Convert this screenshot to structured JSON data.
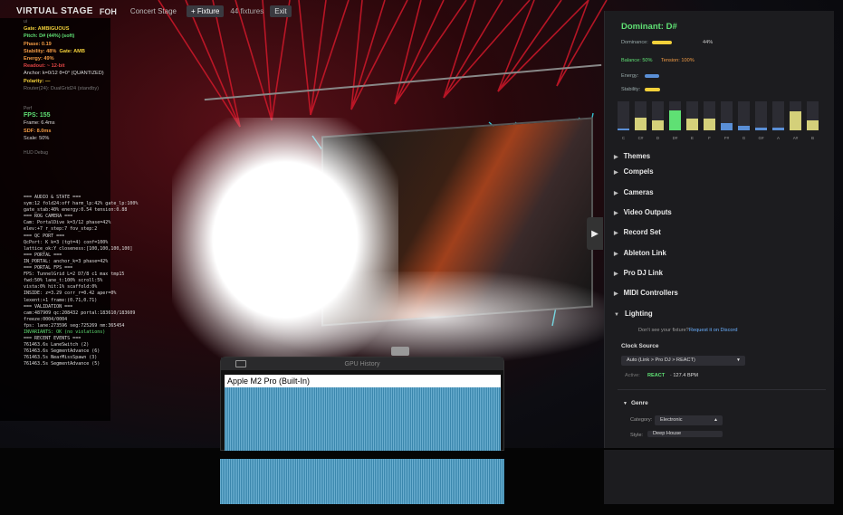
{
  "topbar": {
    "title": "VIRTUAL STAGE",
    "fps": "FOH",
    "concert_stage": "Concert Stage",
    "add_fixture": "+ Fixture",
    "fixture_count": "44 fixtures",
    "exit": "Exit"
  },
  "hud": {
    "head_ui": "ui",
    "gate": "Gate: AMBIGUOUS",
    "pitch": "Pitch: D# (44%) (soft)",
    "phase": "Phase: 0.19",
    "stability": "Stability: 48%",
    "gate_amb": "Gate: AMB",
    "energy": "Energy: 49%",
    "readout": "Readout: ~ 12-bit",
    "anchor": "Anchor: k=0/12 θ=0° (QUANTIZED)",
    "polarity": "Polarity: —",
    "router": "Router(24): DualGrid24 (standby)",
    "head_perf": "Perf",
    "fps": "FPS: 155",
    "frame": "Frame: 6.4ms",
    "sdf": "SDF: 8.0ms",
    "scale": "Scale: 50%",
    "head_debug": "HUD Debug"
  },
  "log": [
    {
      "t": "=== AUDIO & STATE ===",
      "c": "w"
    },
    {
      "t": "sym:12 fold24:off harm_lp:42% gate_lp:100%",
      "c": "w"
    },
    {
      "t": "gate_stab:40% energy:0.54 tension:0.88",
      "c": "w"
    },
    {
      "t": "=== ROG CAMERA ===",
      "c": "w"
    },
    {
      "t": "Cam: PortalDive k=3/12 phase=42%",
      "c": "w"
    },
    {
      "t": "elev:+7 r_step:7 fov_step:2",
      "c": "w"
    },
    {
      "t": "=== QC PORT ===",
      "c": "w"
    },
    {
      "t": "QcPort: K k=3 (tgt=4) conf=100%",
      "c": "w"
    },
    {
      "t": "lattice_ok:Y closeness:[100,100,100,100]",
      "c": "w"
    },
    {
      "t": "=== PORTAL ===",
      "c": "w"
    },
    {
      "t": "IN_PORTAL: anchor_k=3 phase=42%",
      "c": "w"
    },
    {
      "t": "=== PORTAL FPS ===",
      "c": "w"
    },
    {
      "t": "FPS: TunnelGrid L=2 D7/8 c1 max tmp15",
      "c": "w"
    },
    {
      "t": "fwd:50% lane_t:100% scroll:5%",
      "c": "w"
    },
    {
      "t": "vista:0% hit:1% scaffold:0%",
      "c": "w"
    },
    {
      "t": "INSIDE: z=3.29 corr_r=0.42 aper=0%",
      "c": "w"
    },
    {
      "t": "lexent:+1 frame:(0.71,0.71)",
      "c": "w"
    },
    {
      "t": "=== VALIDATION ===",
      "c": "w"
    },
    {
      "t": "cam:487909 qc:208432 portal:183610/183609",
      "c": "w"
    },
    {
      "t": "freeze:0004/0004",
      "c": "w"
    },
    {
      "t": "fps: lane:273596 seg:725269 nm:365454",
      "c": "w"
    },
    {
      "t": "INVARIANTS: OK (no violations)",
      "c": "ok"
    },
    {
      "t": "=== RECENT EVENTS ===",
      "c": "w"
    },
    {
      "t": "761463.6s LaneSwitch (2)",
      "c": "w"
    },
    {
      "t": "761463.6s SegmentAdvance (6)",
      "c": "w"
    },
    {
      "t": "761463.5s NearMissSpawn (3)",
      "c": "w"
    },
    {
      "t": "761463.5s SegmentAdvance (5)",
      "c": "w"
    }
  ],
  "gpu": {
    "title": "GPU History",
    "device": "Apple M2 Pro (Built-In)"
  },
  "panel": {
    "dominant": "Dominant: D#",
    "dominance_label": "Dominance:",
    "dominance_value": "44%",
    "dominance_frac": 0.44,
    "balance": "Balance: 50%",
    "tension": "Tension: 100%",
    "energy_label": "Energy:",
    "energy_frac": 0.45,
    "stability_label": "Stability:",
    "stability_frac": 0.48,
    "notes": [
      {
        "n": "C",
        "v": 0.05,
        "c": "#5a8fd6"
      },
      {
        "n": "C#",
        "v": 0.45,
        "c": "#d4d07a"
      },
      {
        "n": "D",
        "v": 0.35,
        "c": "#d4d07a"
      },
      {
        "n": "D#",
        "v": 0.7,
        "c": "#5fe074"
      },
      {
        "n": "E",
        "v": 0.4,
        "c": "#d4d07a"
      },
      {
        "n": "F",
        "v": 0.4,
        "c": "#d4d07a"
      },
      {
        "n": "F#",
        "v": 0.25,
        "c": "#5a8fd6"
      },
      {
        "n": "G",
        "v": 0.15,
        "c": "#5a8fd6"
      },
      {
        "n": "G#",
        "v": 0.1,
        "c": "#5a8fd6"
      },
      {
        "n": "A",
        "v": 0.1,
        "c": "#5a8fd6"
      },
      {
        "n": "A#",
        "v": 0.65,
        "c": "#d4d07a"
      },
      {
        "n": "B",
        "v": 0.35,
        "c": "#d4d07a"
      }
    ],
    "sections": [
      "Themes",
      "Compels",
      "Cameras",
      "Video Outputs",
      "Record Set",
      "Ableton Link",
      "Pro DJ Link",
      "MIDI Controllers",
      "Lighting"
    ],
    "fixture_prompt": "Don't see your fixture?",
    "fixture_link": "Request it on Discord",
    "clock_source_label": "Clock Source",
    "clock_source_value": "Auto (Link > Pro DJ > REACT)",
    "active_label": "Active:",
    "active_src": "REACT",
    "active_bpm": "· 127.4 BPM",
    "genre_label": "Genre",
    "category_label": "Category:",
    "category_value": "Electronic",
    "style_label": "Style:",
    "style_value": "Deep House"
  },
  "colors": {
    "accent_green": "#5fe074",
    "accent_yellow": "#f2d03a",
    "panel_bg": "#1c1c1f"
  }
}
